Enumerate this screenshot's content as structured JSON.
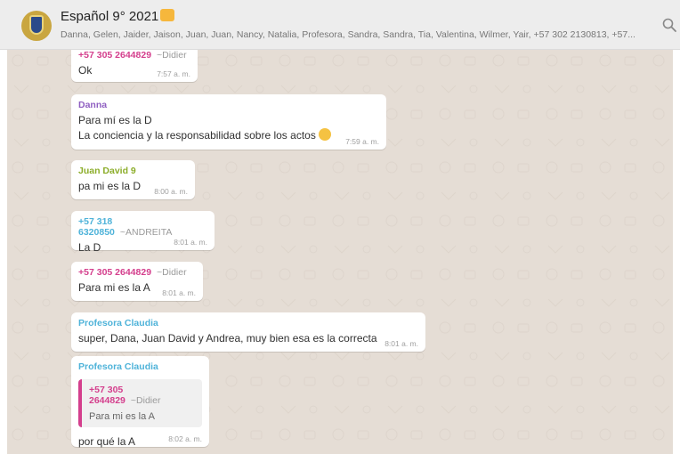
{
  "header": {
    "title": "Español 9° 2021",
    "members": "Danna, Gelen, Jaider, Jaison, Juan, Juan, Nancy, Natalia, Profesora, Sandra, Sandra, Tia, Valentina, Wilmer, Yair, +57 302 2130813, +57..."
  },
  "colors": {
    "pink_sender": "#d43f8d",
    "purple_sender": "#8f5fc1",
    "green_sender": "#8cad2a",
    "blue_sender": "#4fb3d9"
  },
  "messages": [
    {
      "sender": "+57 305 2644829",
      "alias": "~Didier",
      "text": "Ok",
      "time": "7:57 a. m."
    },
    {
      "sender": "Danna",
      "alias": "",
      "text": "Para mí es la D",
      "text2": "La conciencia y la responsabilidad sobre los actos",
      "time": "7:59 a. m."
    },
    {
      "sender": "Juan David 9",
      "alias": "",
      "text": "pa mi es la D",
      "time": "8:00 a. m."
    },
    {
      "sender": "+57 318 6320850",
      "alias": "~ANDREITA",
      "text": "La D",
      "time": "8:01 a. m."
    },
    {
      "sender": "+57 305 2644829",
      "alias": "~Didier",
      "text": "Para mi es la A",
      "time": "8:01 a. m."
    },
    {
      "sender": "Profesora Claudia",
      "alias": "",
      "text": "super, Dana, Juan David y Andrea, muy bien esa es la correcta",
      "time": "8:01 a. m."
    },
    {
      "sender": "Profesora Claudia",
      "alias": "",
      "quote_sender": "+57 305 2644829",
      "quote_alias": "~Didier",
      "quote_text": "Para mi es la A",
      "text": "por qué la A",
      "time": "8:02 a. m."
    }
  ]
}
